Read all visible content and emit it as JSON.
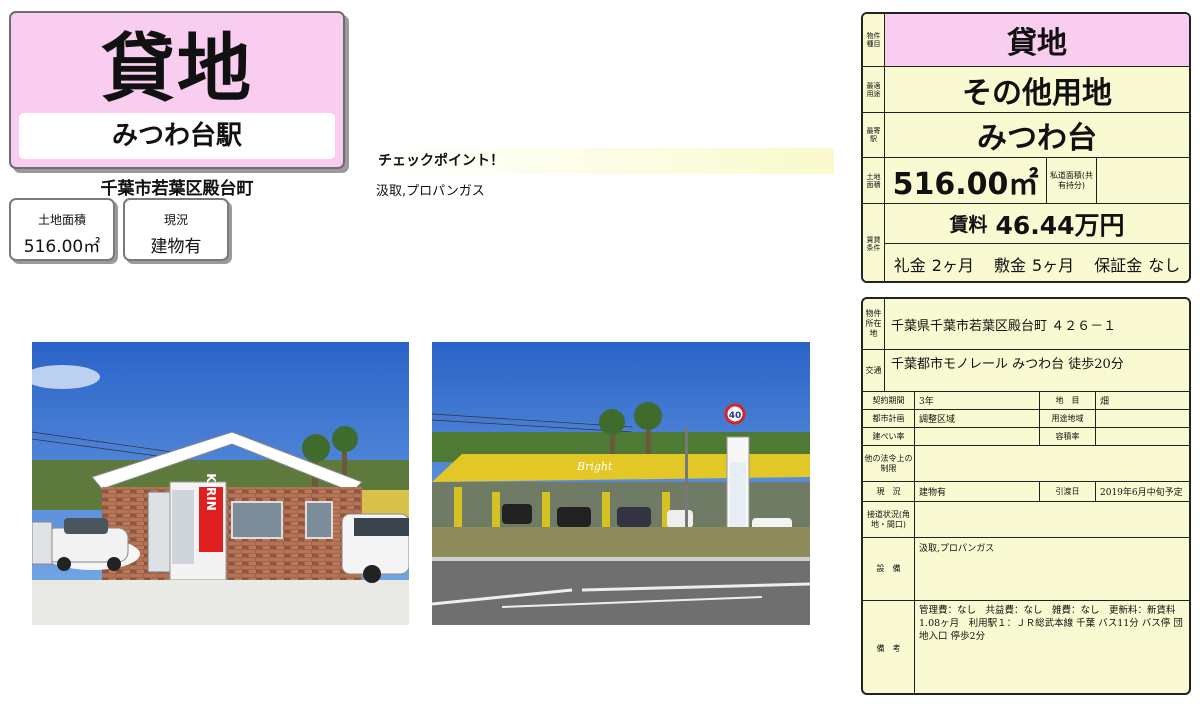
{
  "header": {
    "type_title": "貸地",
    "station": "みつわ台駅",
    "address": "千葉市若葉区殿台町"
  },
  "summary": {
    "area_label": "土地面積",
    "area_value": "516.00㎡",
    "status_label": "現況",
    "status_value": "建物有"
  },
  "checkpoint": {
    "title": "チェックポイント！",
    "text": "汲取,プロパンガス"
  },
  "spec_top": {
    "type_label": "物件種目",
    "type_value": "貸地",
    "use_label": "最適用途",
    "use_value": "その他用地",
    "station_label": "最寄駅",
    "station_value": "みつわ台",
    "area_label": "土地面積",
    "area_value": "516.00㎡",
    "private_area_label": "私道面積(共有持分)",
    "private_area_value": "",
    "rent_conditions_label": "賃貸条件",
    "rent_label": "賃料",
    "rent_value": "46.44万円",
    "key_money_label": "礼金",
    "key_money_value": "2ヶ月",
    "deposit_label": "敷金",
    "deposit_value": "5ヶ月",
    "guarantee_label": "保証金",
    "guarantee_value": "なし"
  },
  "spec_bottom": {
    "location_label": "物件所在地",
    "location_value": "千葉県千葉市若葉区殿台町 ４２６－１",
    "transport_label": "交通",
    "transport_value": "千葉都市モノレール みつわ台 徒歩20分",
    "contract_label": "契約期間",
    "contract_value": "3年",
    "land_category_label": "地　目",
    "land_category_value": "畑",
    "city_plan_label": "都市計画",
    "city_plan_value": "調整区域",
    "zoning_label": "用途地域",
    "zoning_value": "",
    "bcr_label": "建ぺい率",
    "bcr_value": "",
    "far_label": "容積率",
    "far_value": "",
    "other_law_label": "他の法令上の制限",
    "other_law_value": "",
    "current_label": "現　況",
    "current_value": "建物有",
    "handover_label": "引渡日",
    "handover_value": "2019年6月中旬予定",
    "road_label": "接道状況(角地・間口)",
    "road_value": "",
    "facilities_label": "設　備",
    "facilities_value": "汲取,プロパンガス",
    "notes_label": "備　考",
    "notes_value": "管理費：なし　共益費：なし　雑費：なし　更新料：新賃料 1.08ヶ月　利用駅１：ＪＲ総武本線 千葉 バス11分 バス停 団地入口 停歩2分"
  },
  "photos": {
    "photo1_sign": "KIRIN",
    "photo2_sign": "Bright",
    "photo2_speed": "40"
  }
}
